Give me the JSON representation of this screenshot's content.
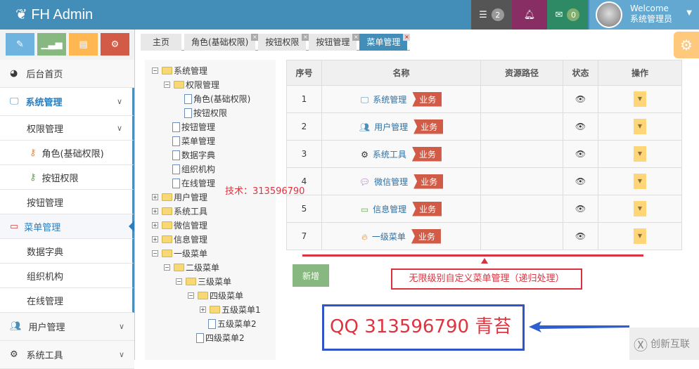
{
  "header": {
    "brand": "FH Admin",
    "tasks_count": "2",
    "messages_count": "0",
    "welcome": "Welcome",
    "user": "系统管理员"
  },
  "colors": {
    "header": "#438eb9",
    "tasks": "#555555",
    "notifications": "#892e65",
    "messages": "#2e8965",
    "user": "#62a8d1"
  },
  "tabs": [
    "主页",
    "角色(基础权限)",
    "按钮权限",
    "按钮管理",
    "菜单管理"
  ],
  "sidebar": {
    "home": "后台首页",
    "system": "系统管理",
    "perm": "权限管理",
    "role": "角色(基础权限)",
    "btnperm": "按钮权限",
    "btnmgr": "按钮管理",
    "menumgr": "菜单管理",
    "dict": "数据字典",
    "org": "组织机构",
    "online": "在线管理",
    "users": "用户管理",
    "tools": "系统工具"
  },
  "tree": [
    "系统管理",
    "权限管理",
    "角色(基础权限)",
    "按钮权限",
    "按钮管理",
    "菜单管理",
    "数据字典",
    "组织机构",
    "在线管理",
    "用户管理",
    "系统工具",
    "微信管理",
    "信息管理",
    "一级菜单",
    "二级菜单",
    "三级菜单",
    "四级菜单",
    "五级菜单1",
    "五级菜单2",
    "四级菜单2"
  ],
  "table": {
    "headers": [
      "序号",
      "名称",
      "资源路径",
      "状态",
      "操作"
    ],
    "tag": "业务",
    "rows": [
      {
        "no": "1",
        "name": "系统管理"
      },
      {
        "no": "2",
        "name": "用户管理"
      },
      {
        "no": "3",
        "name": "系统工具"
      },
      {
        "no": "4",
        "name": "微信管理"
      },
      {
        "no": "5",
        "name": "信息管理"
      },
      {
        "no": "7",
        "name": "一级菜单"
      }
    ]
  },
  "add_button": "新增",
  "annotations": {
    "tech": "技术：313596790",
    "note": "无限级别自定义菜单管理（递归处理）",
    "qq": "QQ 313596790 青苔",
    "watermark": "创新互联"
  }
}
